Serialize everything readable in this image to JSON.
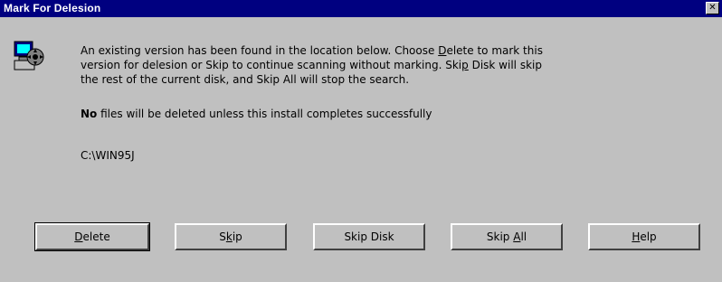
{
  "window": {
    "title": "Mark For Delesion",
    "close_glyph": "✕"
  },
  "icon": {
    "name": "computer-disk-icon"
  },
  "message": {
    "line1_a": "An existing version has been found in the location below.  Choose ",
    "line1_u": "D",
    "line1_b": "elete to mark this",
    "line2_a": "version for delesion or Skip to continue scanning without marking.  Ski",
    "line2_u": "p",
    "line2_b": " Disk will skip",
    "line3": "the rest of the current disk, and Skip All will stop the search."
  },
  "note": {
    "bold_word": "No",
    "rest": " files will be deleted unless this install completes successfully"
  },
  "location": "C:\\WIN95J",
  "buttons": {
    "delete": {
      "u": "D",
      "rest": "elete"
    },
    "skip": {
      "pre": "S",
      "u": "k",
      "rest": "ip"
    },
    "skip_disk": {
      "label": "Skip Disk"
    },
    "skip_all": {
      "pre": "Skip ",
      "u": "A",
      "rest": "ll"
    },
    "help": {
      "u": "H",
      "rest": "elp"
    }
  },
  "colors": {
    "titlebar": "#000080",
    "dialog_bg": "#c0c0c0"
  }
}
